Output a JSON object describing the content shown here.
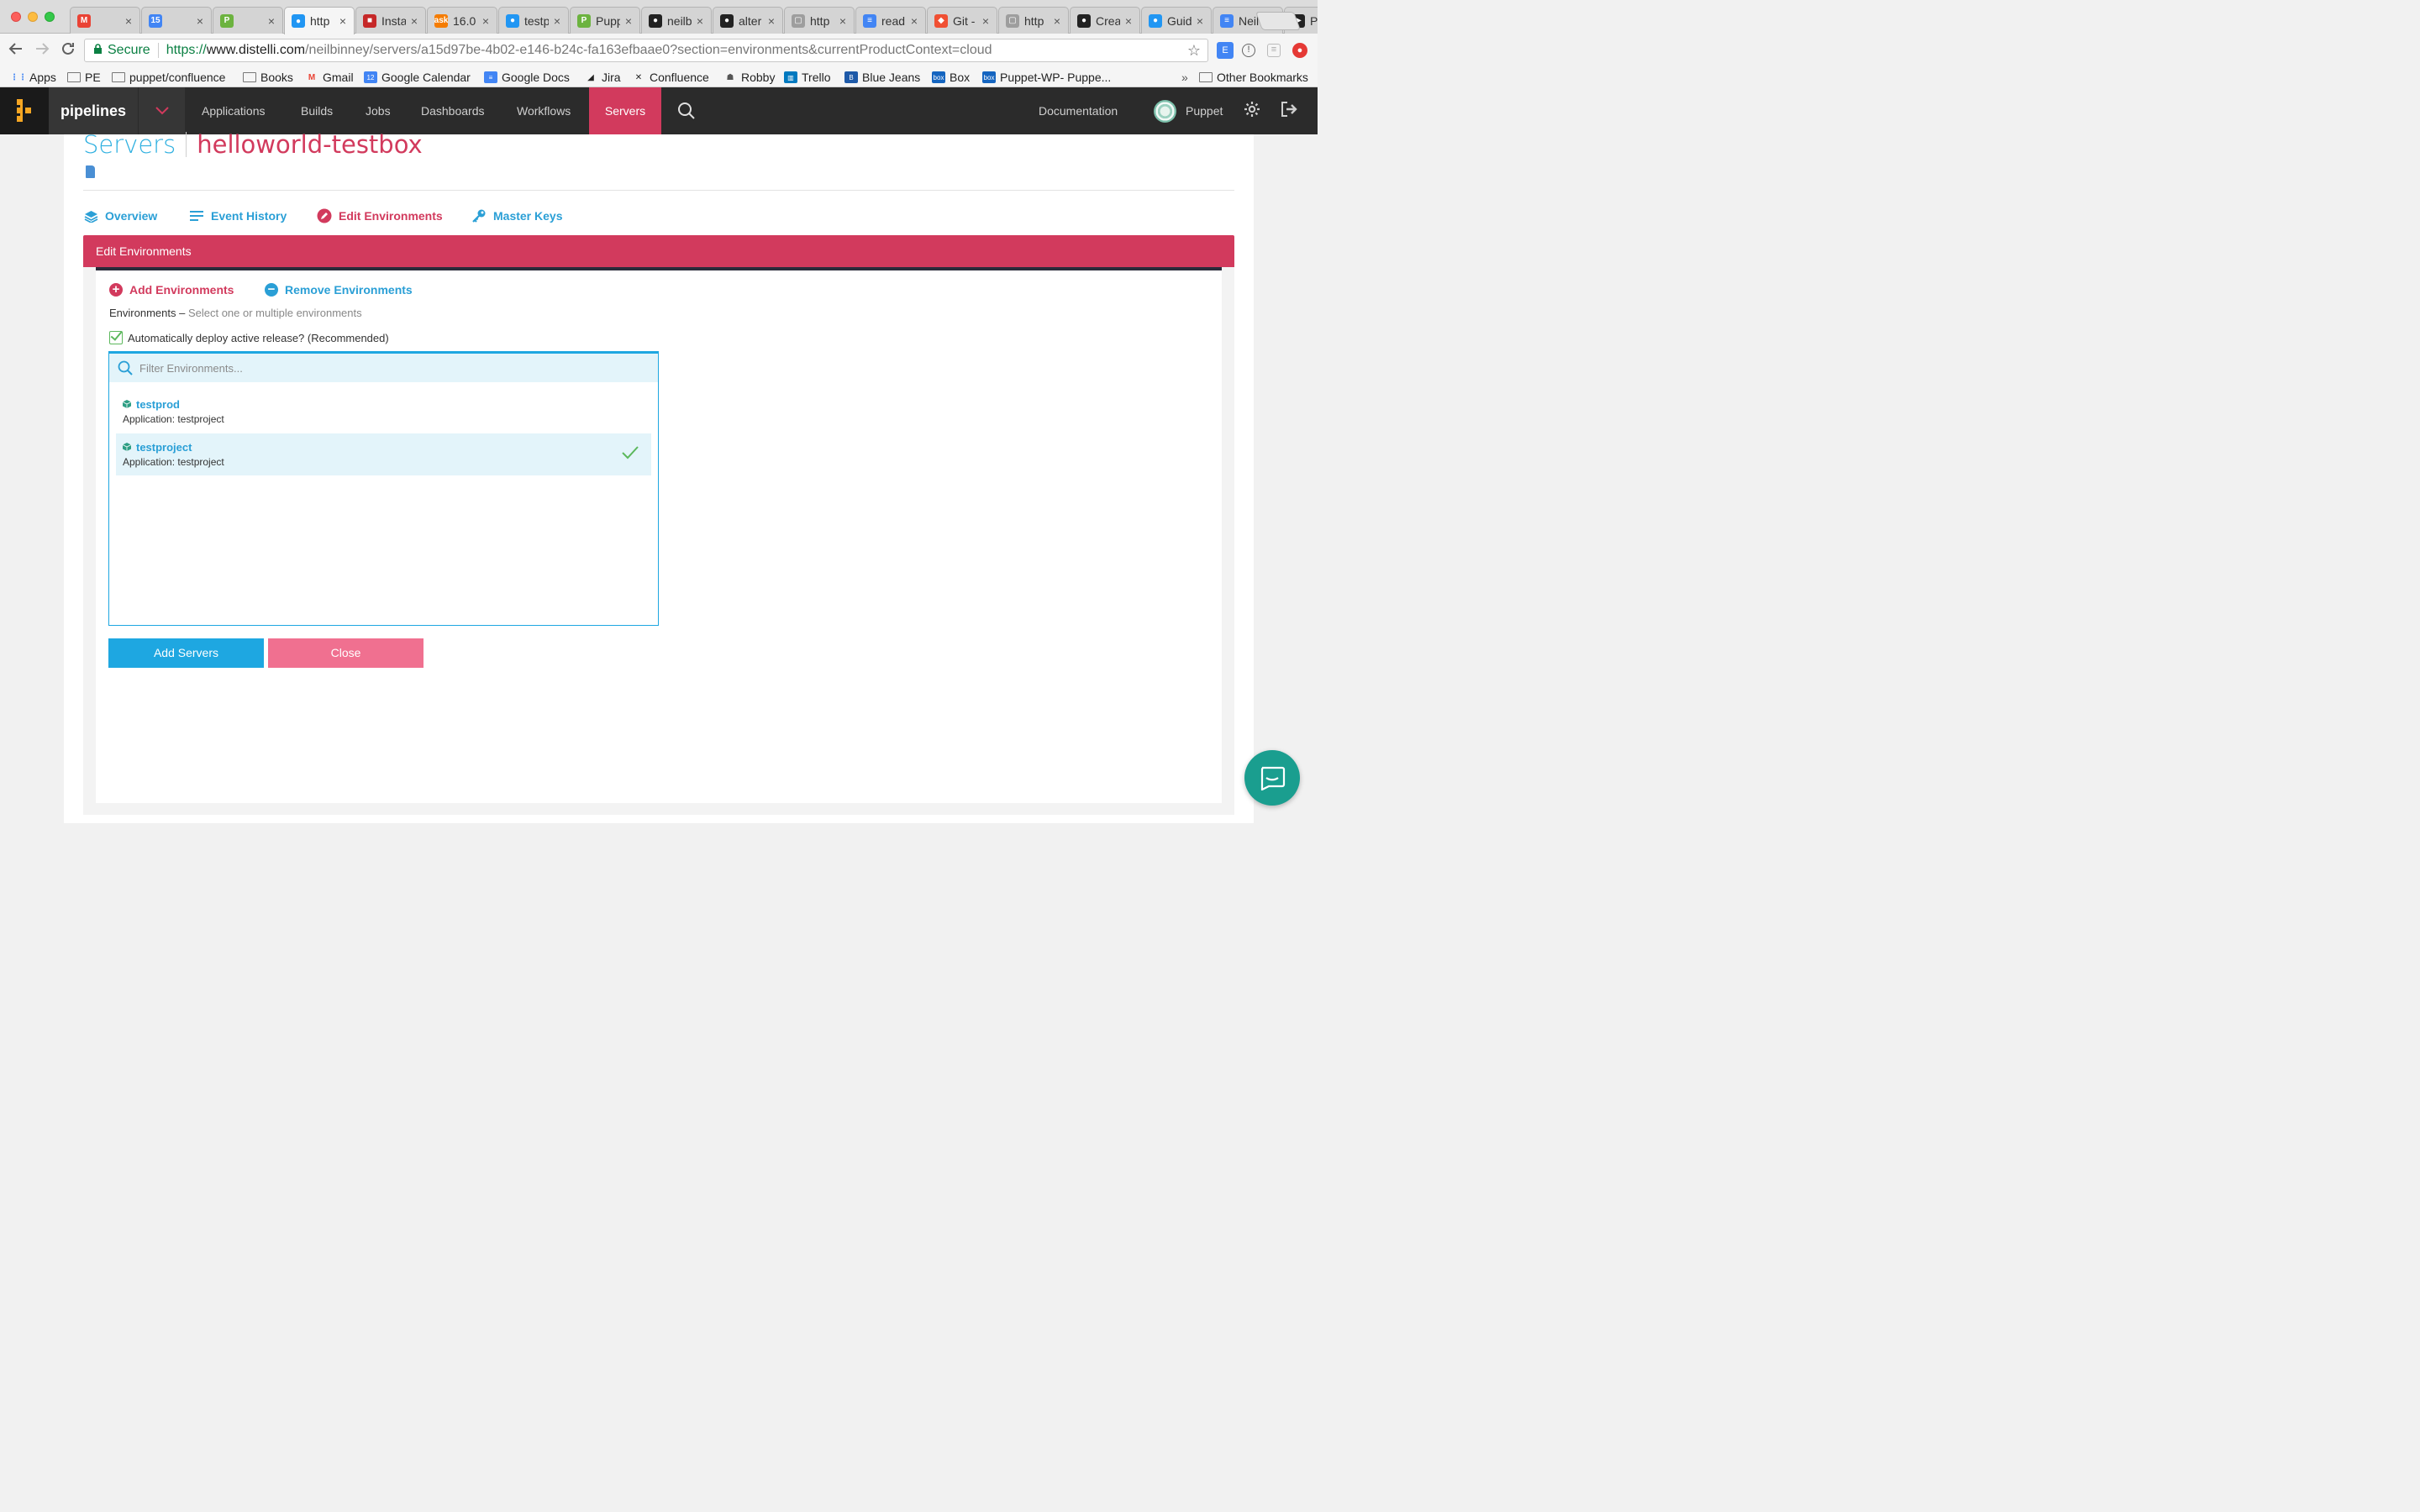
{
  "browser": {
    "tabs": [
      {
        "title": "",
        "favicon": "gmail",
        "color": "#ea4335",
        "glyph": "M"
      },
      {
        "title": "",
        "favicon": "calendar",
        "color": "#4285f4",
        "glyph": "15"
      },
      {
        "title": "",
        "favicon": "puppet-green",
        "color": "#6cb33f",
        "glyph": "P"
      },
      {
        "title": "http",
        "favicon": "blue-dots",
        "color": "#2196f3",
        "glyph": "●",
        "active": true
      },
      {
        "title": "Insta",
        "favicon": "red-square",
        "color": "#c62828",
        "glyph": "■"
      },
      {
        "title": "16.0",
        "favicon": "ask",
        "color": "#f57c00",
        "glyph": "ask"
      },
      {
        "title": "testp",
        "favicon": "blue-dots",
        "color": "#2196f3",
        "glyph": "●"
      },
      {
        "title": "Pupp",
        "favicon": "puppet-green",
        "color": "#6cb33f",
        "glyph": "P"
      },
      {
        "title": "neilb",
        "favicon": "github",
        "color": "#222222",
        "glyph": "●"
      },
      {
        "title": "alter",
        "favicon": "github",
        "color": "#222222",
        "glyph": "●"
      },
      {
        "title": "http",
        "favicon": "page",
        "color": "#9e9e9e",
        "glyph": "▢"
      },
      {
        "title": "read",
        "favicon": "docs",
        "color": "#4285f4",
        "glyph": "≡"
      },
      {
        "title": "Git -",
        "favicon": "git",
        "color": "#f05033",
        "glyph": "◆"
      },
      {
        "title": "http",
        "favicon": "page",
        "color": "#9e9e9e",
        "glyph": "▢"
      },
      {
        "title": "Crea",
        "favicon": "github",
        "color": "#222222",
        "glyph": "●"
      },
      {
        "title": "Guid",
        "favicon": "blue-dots",
        "color": "#2196f3",
        "glyph": "●"
      },
      {
        "title": "Neil",
        "favicon": "docs",
        "color": "#4285f4",
        "glyph": "≡"
      },
      {
        "title": "Pupp",
        "favicon": "puppet-dark",
        "color": "#222222",
        "glyph": "▶"
      }
    ],
    "address": {
      "secure_label": "Secure",
      "scheme": "https://",
      "domain": "www.distelli.com",
      "path": "/neilbinney/servers/a15d97be-4b02-e146-b24c-fa163efbaae0?section=environments&currentProductContext=cloud"
    },
    "bookmarks": [
      {
        "label": "Apps",
        "icon": "apps-grid-icon"
      },
      {
        "label": "PE",
        "icon": "folder-icon"
      },
      {
        "label": "puppet/confluence",
        "icon": "folder-icon"
      },
      {
        "label": "Books",
        "icon": "folder-icon"
      },
      {
        "label": "Gmail",
        "icon": "gmail-icon"
      },
      {
        "label": "Google Calendar",
        "icon": "calendar-icon"
      },
      {
        "label": "Google Docs",
        "icon": "docs-icon"
      },
      {
        "label": "Jira",
        "icon": "jira-icon"
      },
      {
        "label": "Confluence",
        "icon": "confluence-icon"
      },
      {
        "label": "Robby",
        "icon": "robot-icon"
      },
      {
        "label": "Trello",
        "icon": "trello-icon"
      },
      {
        "label": "Blue Jeans",
        "icon": "bluejeans-icon"
      },
      {
        "label": "Box",
        "icon": "box-icon"
      },
      {
        "label": "Puppet-WP- Puppe...",
        "icon": "box-icon"
      }
    ],
    "bookmarks_overflow": "»",
    "other_bookmarks": "Other Bookmarks"
  },
  "app": {
    "brand": "pipelines",
    "nav": {
      "items": [
        "Applications",
        "Builds",
        "Jobs",
        "Dashboards",
        "Workflows",
        "Servers"
      ],
      "active": "Servers",
      "documentation": "Documentation",
      "user": "Puppet"
    }
  },
  "page": {
    "breadcrumb_root": "Servers",
    "server_name": "helloworld-testbox",
    "subtabs": [
      {
        "label": "Overview",
        "icon": "layers-icon"
      },
      {
        "label": "Event History",
        "icon": "list-icon"
      },
      {
        "label": "Edit Environments",
        "icon": "edit-icon",
        "active": true
      },
      {
        "label": "Master Keys",
        "icon": "key-icon"
      }
    ],
    "panel_title": "Edit Environments",
    "add_environments": "Add Environments",
    "remove_environments": "Remove Environments",
    "environments_label": "Environments",
    "environments_dash": " – ",
    "environments_hint": "Select one or multiple environments",
    "auto_deploy_label": "Automatically deploy active release? (Recommended)",
    "auto_deploy_checked": true,
    "filter_placeholder": "Filter Environments...",
    "environments": [
      {
        "name": "testprod",
        "application": "Application: testproject",
        "selected": false
      },
      {
        "name": "testproject",
        "application": "Application: testproject",
        "selected": true
      }
    ],
    "add_servers_button": "Add Servers",
    "close_button": "Close"
  },
  "colors": {
    "accent_red": "#d23a5d",
    "accent_blue": "#1ea7e1",
    "nav_bg": "#2b2b2b",
    "chat_bg": "#1a9e8f"
  }
}
